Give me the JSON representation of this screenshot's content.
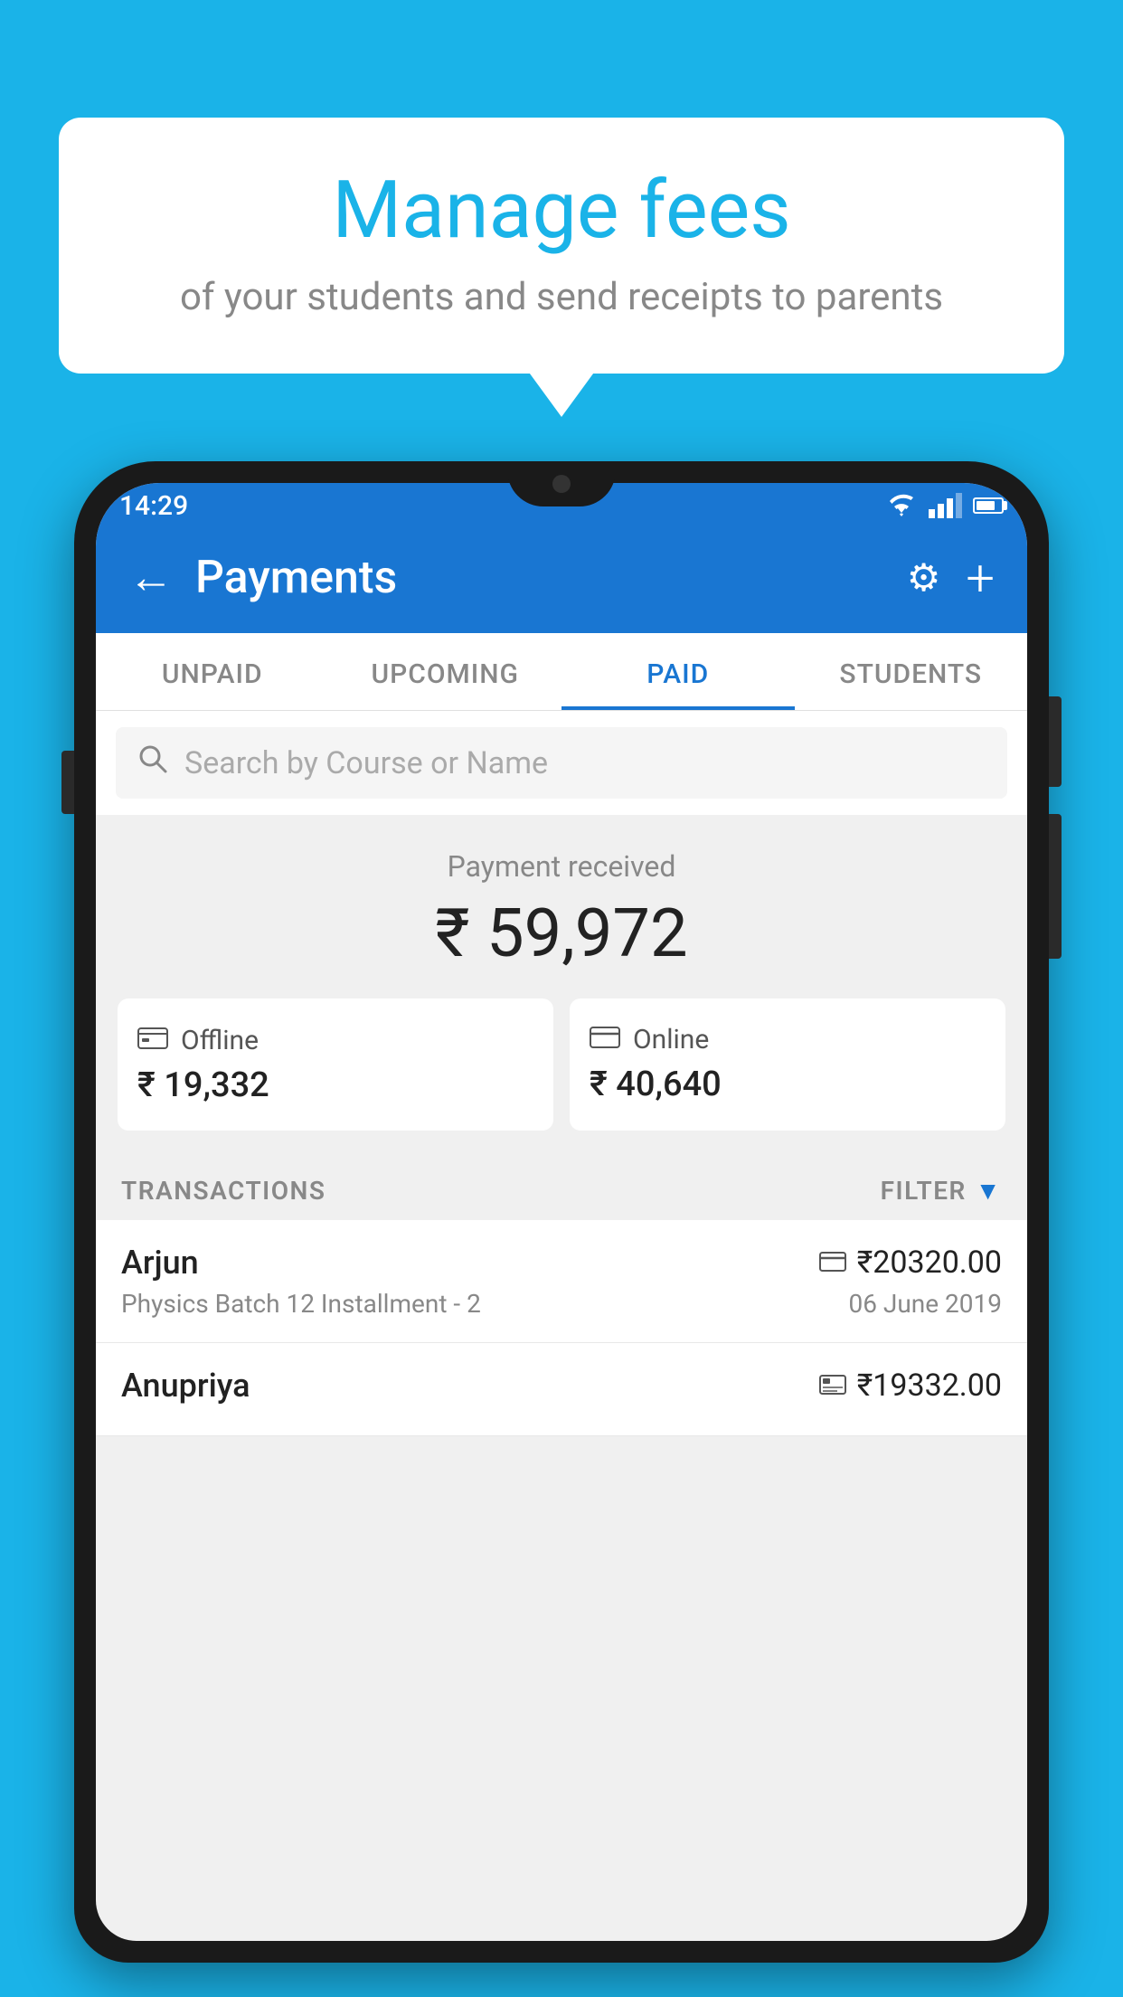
{
  "background_color": "#1ab3e8",
  "bubble": {
    "title": "Manage fees",
    "subtitle": "of your students and send receipts to parents"
  },
  "status_bar": {
    "time": "14:29"
  },
  "header": {
    "title": "Payments",
    "back_label": "←",
    "settings_label": "⚙",
    "add_label": "+"
  },
  "tabs": [
    {
      "label": "UNPAID",
      "active": false
    },
    {
      "label": "UPCOMING",
      "active": false
    },
    {
      "label": "PAID",
      "active": true
    },
    {
      "label": "STUDENTS",
      "active": false
    }
  ],
  "search": {
    "placeholder": "Search by Course or Name"
  },
  "payment_summary": {
    "label": "Payment received",
    "total": "₹ 59,972",
    "offline_label": "Offline",
    "offline_amount": "₹ 19,332",
    "online_label": "Online",
    "online_amount": "₹ 40,640"
  },
  "transactions": {
    "section_label": "TRANSACTIONS",
    "filter_label": "FILTER",
    "items": [
      {
        "name": "Arjun",
        "course": "Physics Batch 12 Installment - 2",
        "amount": "₹20320.00",
        "date": "06 June 2019",
        "payment_type": "card"
      },
      {
        "name": "Anupriya",
        "course": "",
        "amount": "₹19332.00",
        "date": "",
        "payment_type": "cash"
      }
    ]
  }
}
